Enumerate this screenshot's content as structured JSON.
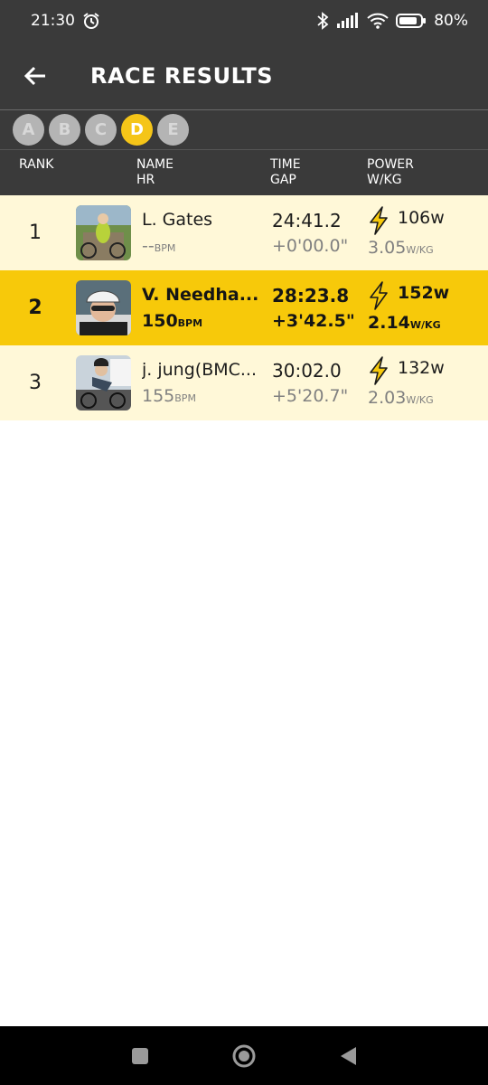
{
  "status_bar": {
    "time": "21:30",
    "battery": "80%"
  },
  "app_bar": {
    "title": "RACE RESULTS"
  },
  "categories": [
    {
      "label": "A",
      "active": false
    },
    {
      "label": "B",
      "active": false
    },
    {
      "label": "C",
      "active": false
    },
    {
      "label": "D",
      "active": true
    },
    {
      "label": "E",
      "active": false
    }
  ],
  "table_header": {
    "rank": "RANK",
    "name": "NAME",
    "hr": "HR",
    "time": "TIME",
    "gap": "GAP",
    "power": "POWER",
    "wkg": "W/KG"
  },
  "results": [
    {
      "rank": "1",
      "name": "L. Gates",
      "hr": "--",
      "hr_unit": "BPM",
      "time": "24:41.2",
      "gap": "+0'00.0\"",
      "watts": "106w",
      "wkg": "3.05",
      "wkg_unit": "W/KG",
      "highlighted": false
    },
    {
      "rank": "2",
      "name": "V. Needha...",
      "hr": "150",
      "hr_unit": "BPM",
      "time": "28:23.8",
      "gap": "+3'42.5\"",
      "watts": "152w",
      "wkg": "2.14",
      "wkg_unit": "W/KG",
      "highlighted": true
    },
    {
      "rank": "3",
      "name": "j. jung(BMC...",
      "hr": "155",
      "hr_unit": "BPM",
      "time": "30:02.0",
      "gap": "+5'20.7\"",
      "watts": "132w",
      "wkg": "2.03",
      "wkg_unit": "W/KG",
      "highlighted": false
    }
  ],
  "colors": {
    "accent": "#f7c90a",
    "row_bg": "#fff8d8",
    "bar_bg": "#3a3a3a"
  }
}
